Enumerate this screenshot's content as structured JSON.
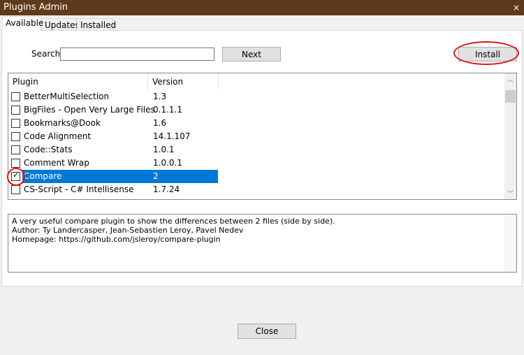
{
  "title": "Plugins Admin",
  "tabs": [
    "Available",
    "Updates",
    "Installed"
  ],
  "search": {
    "label": "Search:",
    "value": ""
  },
  "buttons": {
    "next": "Next",
    "install": "Install",
    "close": "Close",
    "window_close": "×"
  },
  "columns": [
    "Plugin",
    "Version"
  ],
  "plugins": [
    {
      "name": "BetterMultiSelection",
      "version": "1.3",
      "checked": false
    },
    {
      "name": "BigFiles - Open Very Large Files",
      "version": "0.1.1.1",
      "checked": false
    },
    {
      "name": "Bookmarks@Dook",
      "version": "1.6",
      "checked": false
    },
    {
      "name": "Code Alignment",
      "version": "14.1.107",
      "checked": false
    },
    {
      "name": "Code::Stats",
      "version": "1.0.1",
      "checked": false
    },
    {
      "name": "Comment Wrap",
      "version": "1.0.0.1",
      "checked": false
    },
    {
      "name": "Compare",
      "version": "2",
      "checked": true,
      "selected": true
    },
    {
      "name": "CS-Script - C# Intellisense",
      "version": "1.7.24",
      "checked": false
    }
  ],
  "description": [
    "A very useful compare plugin to show the differences between 2 files (side by side).",
    "Author: Ty Landercasper, Jean-Sebastien Leroy, Pavel Nedev",
    "Homepage: https://github.com/jsleroy/compare-plugin"
  ],
  "colors": {
    "titlebar": "#5f3a1a",
    "selection": "#0078d7",
    "highlight": "#e01010"
  }
}
